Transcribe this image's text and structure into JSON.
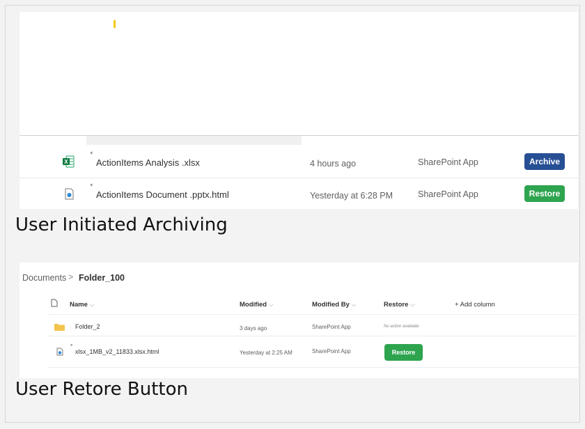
{
  "archiving_panel": {
    "rows": [
      {
        "name": "ActionItems Analysis .xlsx",
        "modified": "4 hours ago",
        "modified_by": "SharePoint App",
        "action": "Archive",
        "action_color": "#264f94",
        "icon": "excel-file-icon"
      },
      {
        "name": "ActionItems Document .pptx.html",
        "modified": "Yesterday at 6:28 PM",
        "modified_by": "SharePoint App",
        "action": "Restore",
        "action_color": "#2ea44f",
        "icon": "web-file-icon"
      }
    ],
    "caption": "User Initiated Archiving"
  },
  "restore_panel": {
    "breadcrumb": {
      "root": "Documents",
      "separator": ">",
      "current": "Folder_100"
    },
    "headers": {
      "name": "Name",
      "modified": "Modified",
      "modified_by": "Modified By",
      "restore": "Restore",
      "add_column": "+ Add column"
    },
    "rows": [
      {
        "name": "Folder_2",
        "modified": "3 days ago",
        "modified_by": "SharePoint App",
        "restore": "No action available",
        "icon": "folder-icon"
      },
      {
        "name": "xlsx_1MB_v2_11833.xlsx.html",
        "modified": "Yesterday at 2:25 AM",
        "modified_by": "SharePoint App",
        "restore": "Restore",
        "icon": "web-file-icon"
      }
    ],
    "caption": "User Retore Button"
  },
  "colors": {
    "archive": "#264f94",
    "restore": "#2ea44f",
    "folder": "#f2c44e",
    "accent_yellow": "#f2c811"
  }
}
